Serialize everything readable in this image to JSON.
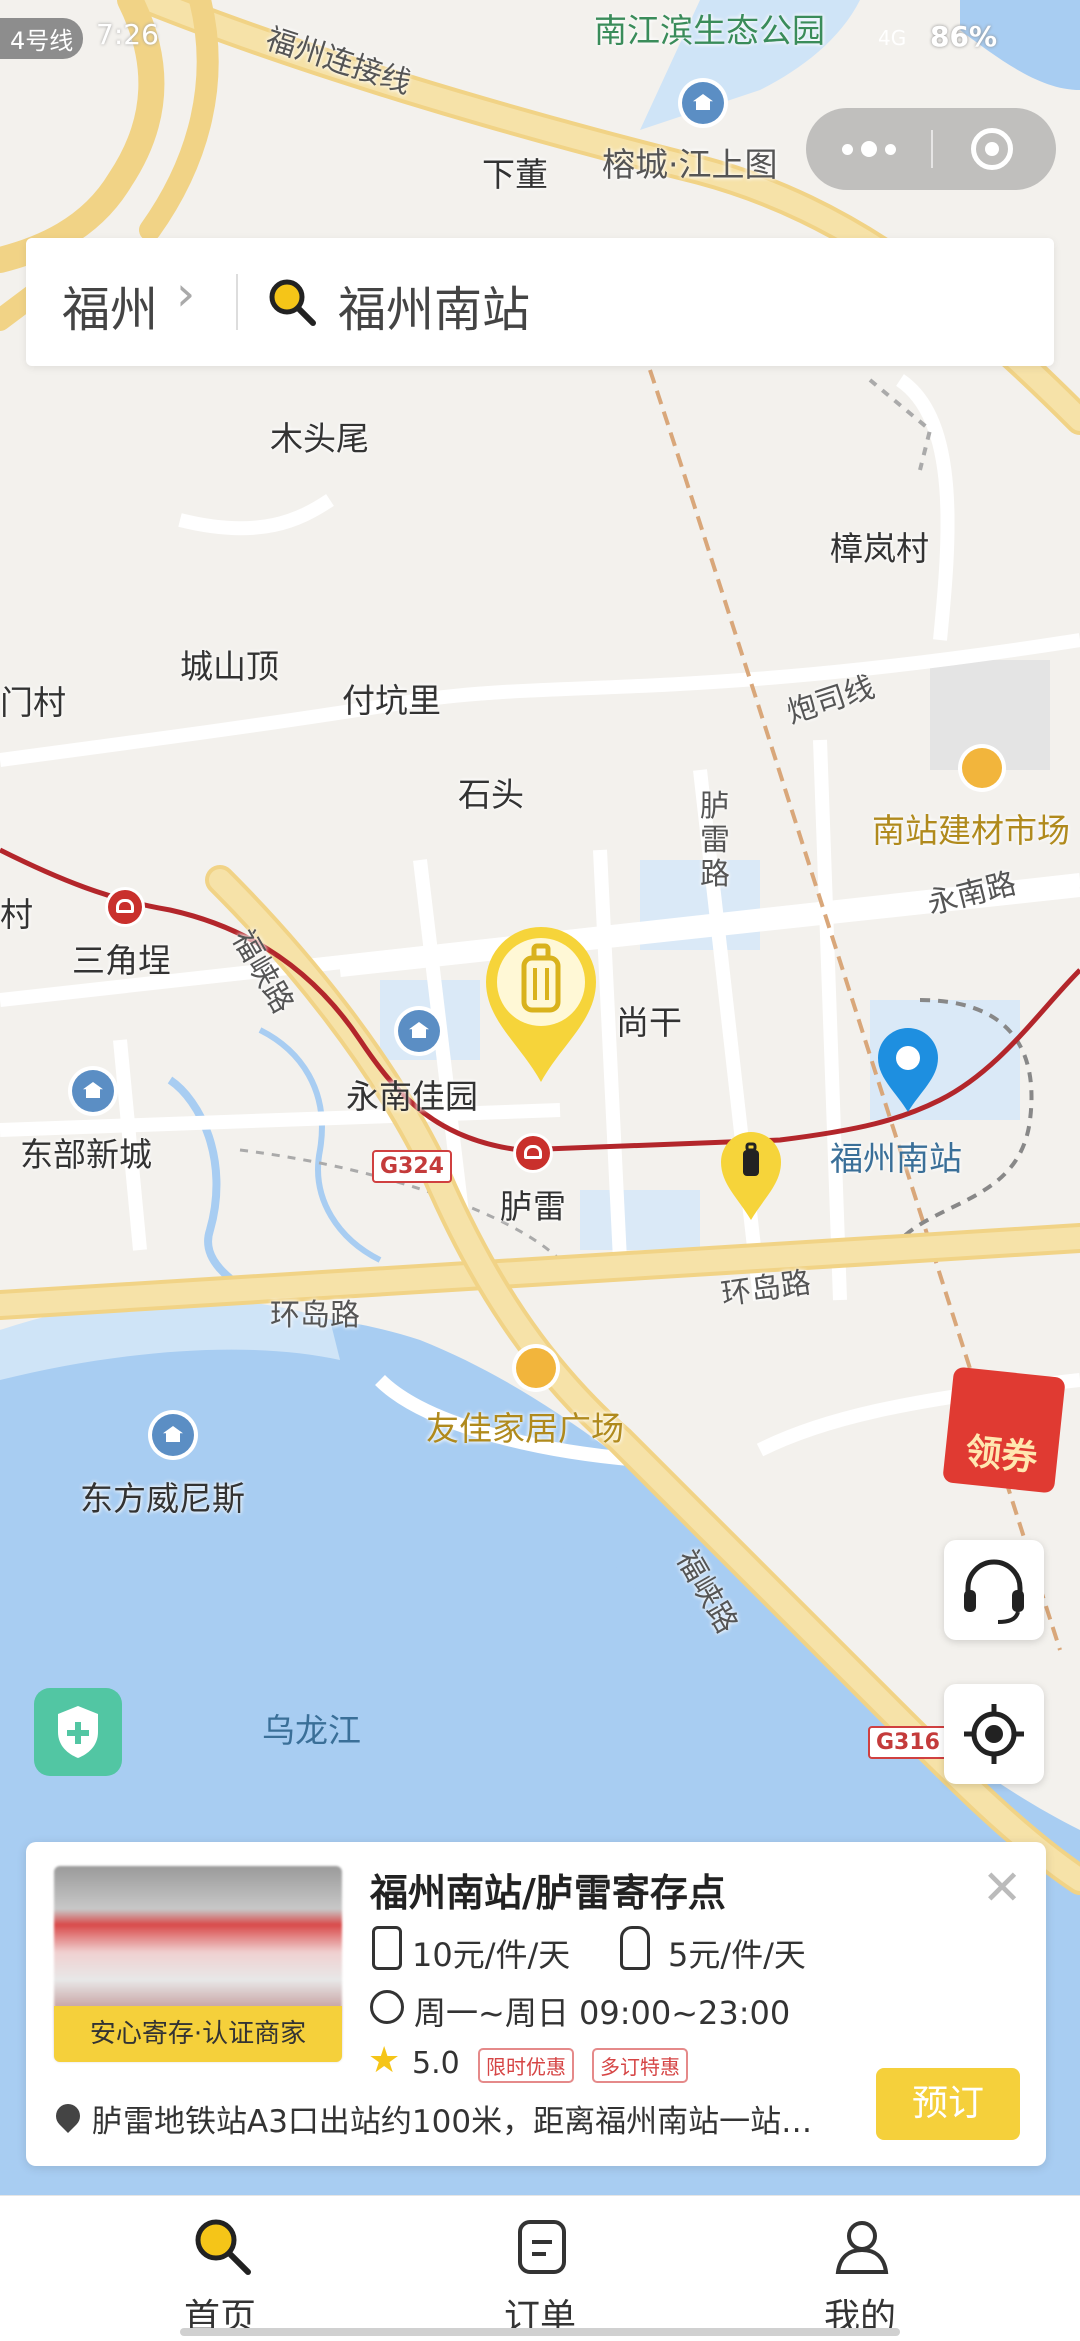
{
  "status_bar": {
    "line_badge": "4号线",
    "time": "7:26",
    "network": "4G",
    "battery": "86%"
  },
  "search": {
    "city": "福州",
    "query": "福州南站"
  },
  "map": {
    "places": {
      "nanjiang_park": "南江滨生态公园",
      "fuzhou_link": "福州连接线",
      "xiadong": "下董",
      "rongcheng": "榕城·江上图",
      "mutouwei": "木头尾",
      "zhanglancun": "樟岚村",
      "paosi": "炮司线",
      "chengshanding": "城山顶",
      "fukengli": "付坑里",
      "mencun": "门村",
      "shitou": "石头",
      "nanzhan_market": "南站建材市场",
      "yongnan_road": "永南路",
      "lulei_road": "胪雷路",
      "cun": "村",
      "sanjiaobu": "三角埕",
      "fuxia_road_1": "福峡路",
      "shanggan": "尚干",
      "yongnan_garden": "永南佳园",
      "dongbu_city": "东部新城",
      "fuzhou_south": "福州南站",
      "g324": "G324",
      "lulei": "胪雷",
      "huandao_1": "环岛路",
      "huandao_2": "环岛路",
      "youjia": "友佳家居广场",
      "dongfang_venice": "东方威尼斯",
      "fuxia_road_2": "福峡路",
      "wulongjiang": "乌龙江",
      "g316": "G316"
    }
  },
  "coupon_label": "领券",
  "card": {
    "title": "福州南站/胪雷寄存点",
    "badge": "安心寄存·认证商家",
    "price_large": "10元/件/天",
    "price_small": "5元/件/天",
    "hours": "周一~周日 09:00~23:00",
    "rating": "5.0",
    "tags": [
      "限时优惠",
      "多订特惠"
    ],
    "address": "胪雷地铁站A3口出站约100米，距离福州南站一站…",
    "book_label": "预订"
  },
  "tabs": [
    {
      "label": "首页"
    },
    {
      "label": "订单"
    },
    {
      "label": "我的"
    }
  ]
}
